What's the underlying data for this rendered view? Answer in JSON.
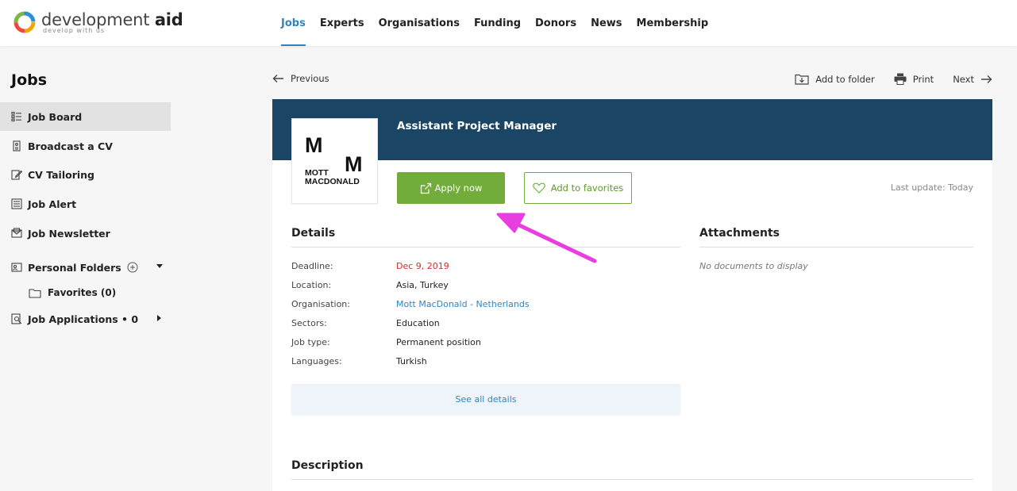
{
  "brand": {
    "name_main": "development",
    "name_bold": "aid",
    "tagline": "develop with us"
  },
  "nav": {
    "items": [
      {
        "label": "Jobs",
        "active": true
      },
      {
        "label": "Experts"
      },
      {
        "label": "Organisations"
      },
      {
        "label": "Funding"
      },
      {
        "label": "Donors"
      },
      {
        "label": "News"
      },
      {
        "label": "Membership"
      }
    ]
  },
  "sidebar": {
    "title": "Jobs",
    "items": [
      {
        "label": "Job Board",
        "icon": "job-board-icon",
        "active": true
      },
      {
        "label": "Broadcast a CV",
        "icon": "cv-icon"
      },
      {
        "label": "CV Tailoring",
        "icon": "edit-icon"
      },
      {
        "label": "Job Alert",
        "icon": "list-icon"
      },
      {
        "label": "Job Newsletter",
        "icon": "envelope-icon"
      },
      {
        "label": "Personal Folders",
        "icon": "folder-user-icon"
      },
      {
        "label": "Job Applications • 0",
        "icon": "search-doc-icon"
      }
    ],
    "folders": [
      {
        "label": "Favorites (0)",
        "icon": "folder-icon"
      }
    ]
  },
  "pager": {
    "previous": "Previous",
    "add_to_folder": "Add to folder",
    "print": "Print",
    "next": "Next"
  },
  "job": {
    "title": "Assistant Project Manager",
    "company_logo_letters": [
      "M",
      "M"
    ],
    "company_logo_name": [
      "MOTT",
      "MACDONALD"
    ],
    "apply_label": "Apply now",
    "favorites_label": "Add to favorites",
    "last_update": "Last update: Today"
  },
  "details": {
    "title": "Details",
    "rows": [
      {
        "label": "Deadline:",
        "value": "Dec 9, 2019"
      },
      {
        "label": "Location:",
        "value": "Asia, Turkey"
      },
      {
        "label": "Organisation:",
        "value": "Mott MacDonald - Netherlands"
      },
      {
        "label": "Sectors:",
        "value": "Education"
      },
      {
        "label": "Job type:",
        "value": "Permanent position"
      },
      {
        "label": "Languages:",
        "value": "Turkish"
      }
    ],
    "see_all": "See all details"
  },
  "attachments": {
    "title": "Attachments",
    "empty": "No documents to display"
  },
  "description": {
    "title": "Description"
  },
  "colors": {
    "accent_blue": "#2e86c1",
    "header_navy": "#1a4565",
    "apply_green": "#72ad3c",
    "deadline_red": "#d0312d",
    "annotation_magenta": "#e83ee0"
  }
}
